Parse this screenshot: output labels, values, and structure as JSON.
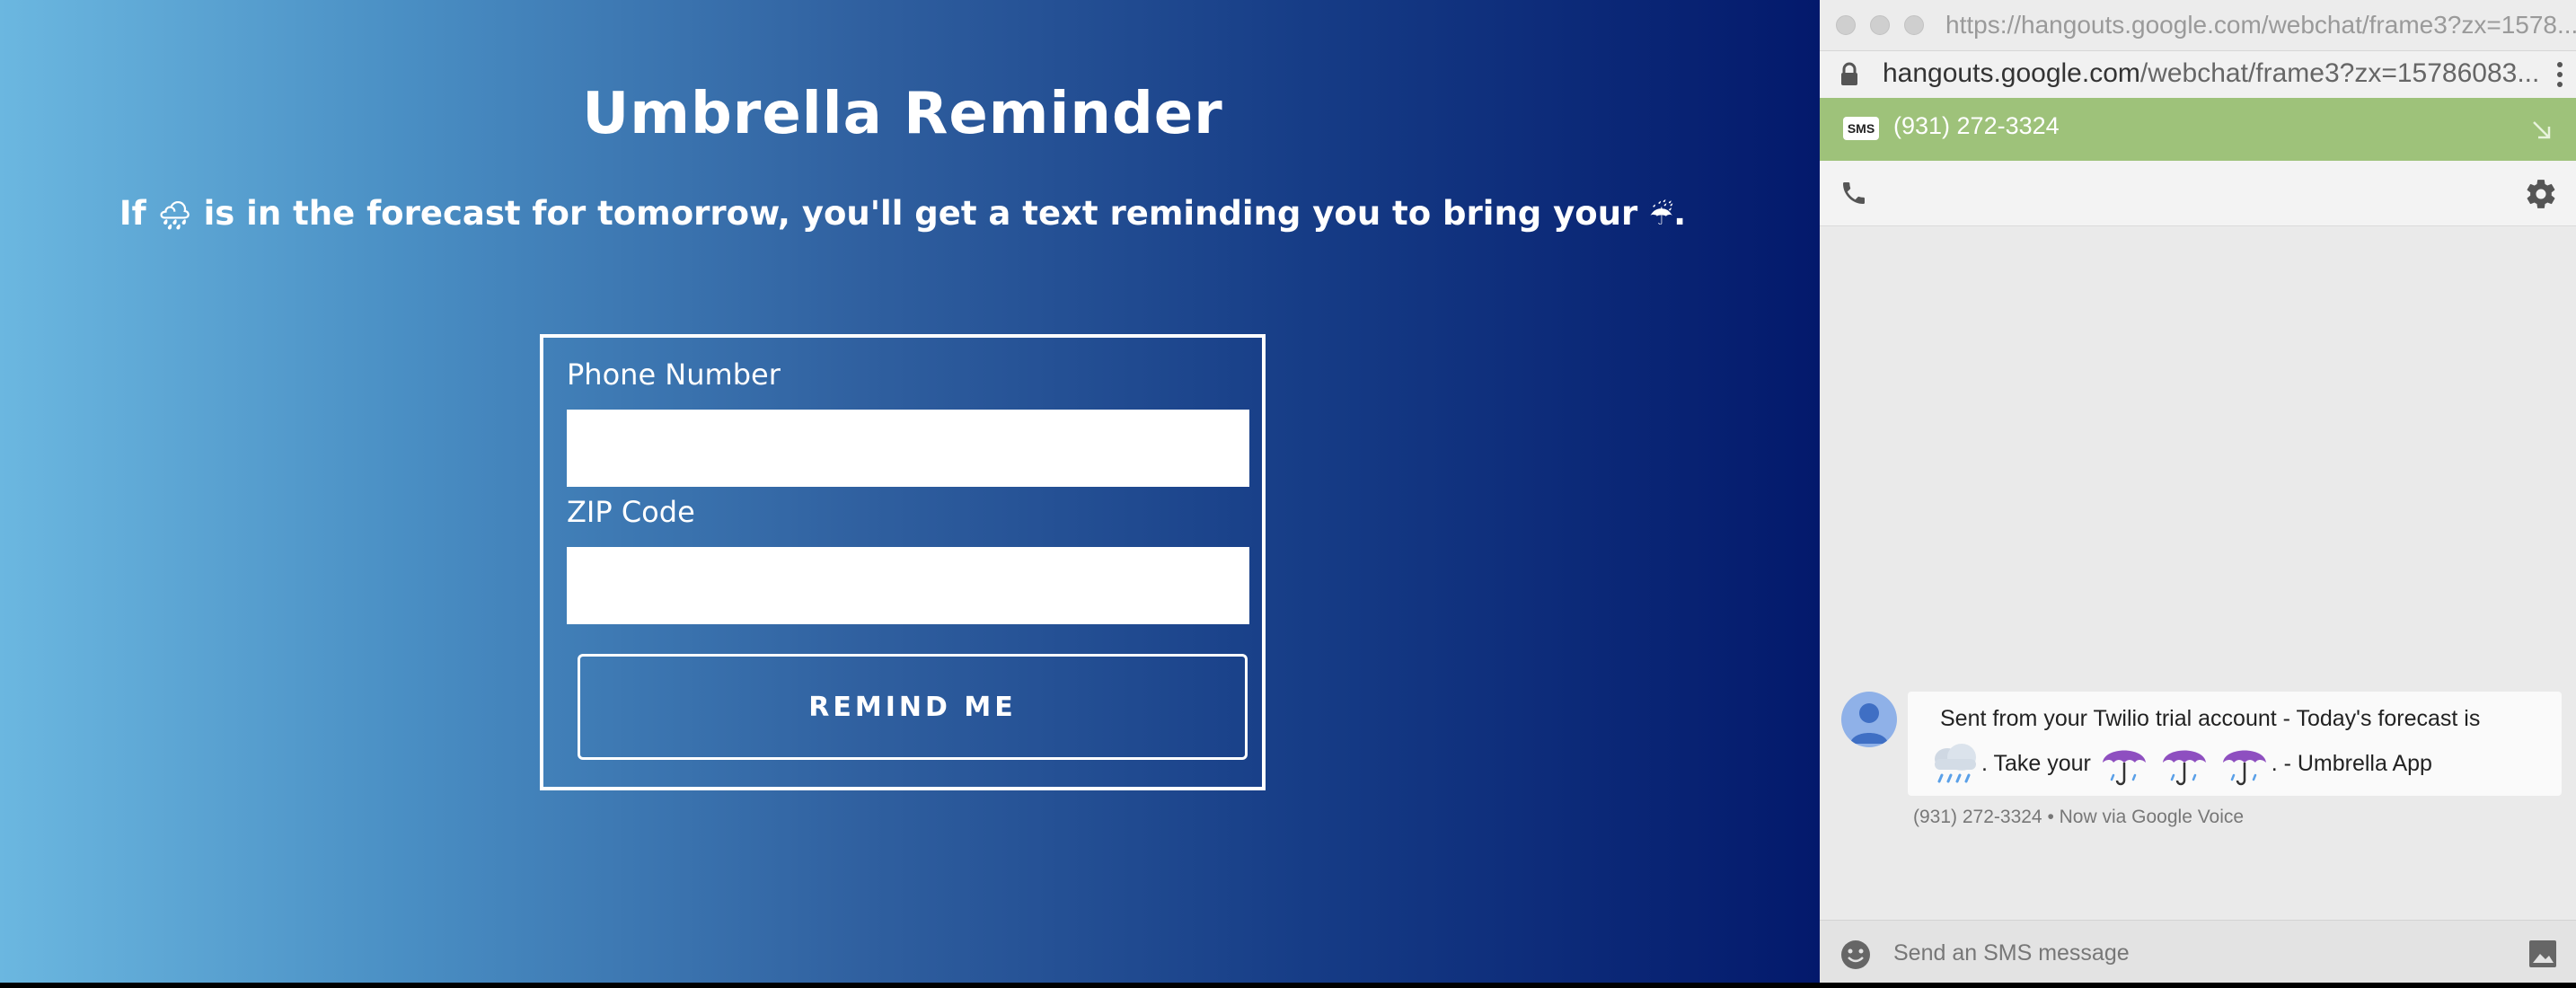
{
  "reminder_page": {
    "title": "Umbrella Reminder",
    "subtitle_before": "If ",
    "subtitle_middle": " is in the forecast for tomorrow, you'll get a text reminding you to bring your ",
    "subtitle_after": ".",
    "rain_emoji": "🌧",
    "umbrella_emoji": "☔",
    "form": {
      "phone_label": "Phone Number",
      "phone_value": "",
      "zip_label": "ZIP Code",
      "zip_value": "",
      "submit_label": "REMIND ME"
    }
  },
  "hangouts": {
    "titlebar_url": "https://hangouts.google.com/webchat/frame3?zx=1578...",
    "address_domain": "hangouts.google.com",
    "address_path": "/webchat/frame3?zx=15786083...",
    "sms_badge": "SMS",
    "contact_number": "(931) 272-3324",
    "message": {
      "line1": "Sent from your Twilio trial account - Today's forecast is",
      "line2_take": ". Take your",
      "line2_end": ". - Umbrella App",
      "meta": "(931) 272-3324 • Now  via Google Voice"
    },
    "compose_placeholder": "Send an SMS message",
    "colors": {
      "header_green": "#9ec27a",
      "gradient_dark": "#03196c",
      "gradient_light": "#6bb7e0"
    }
  }
}
